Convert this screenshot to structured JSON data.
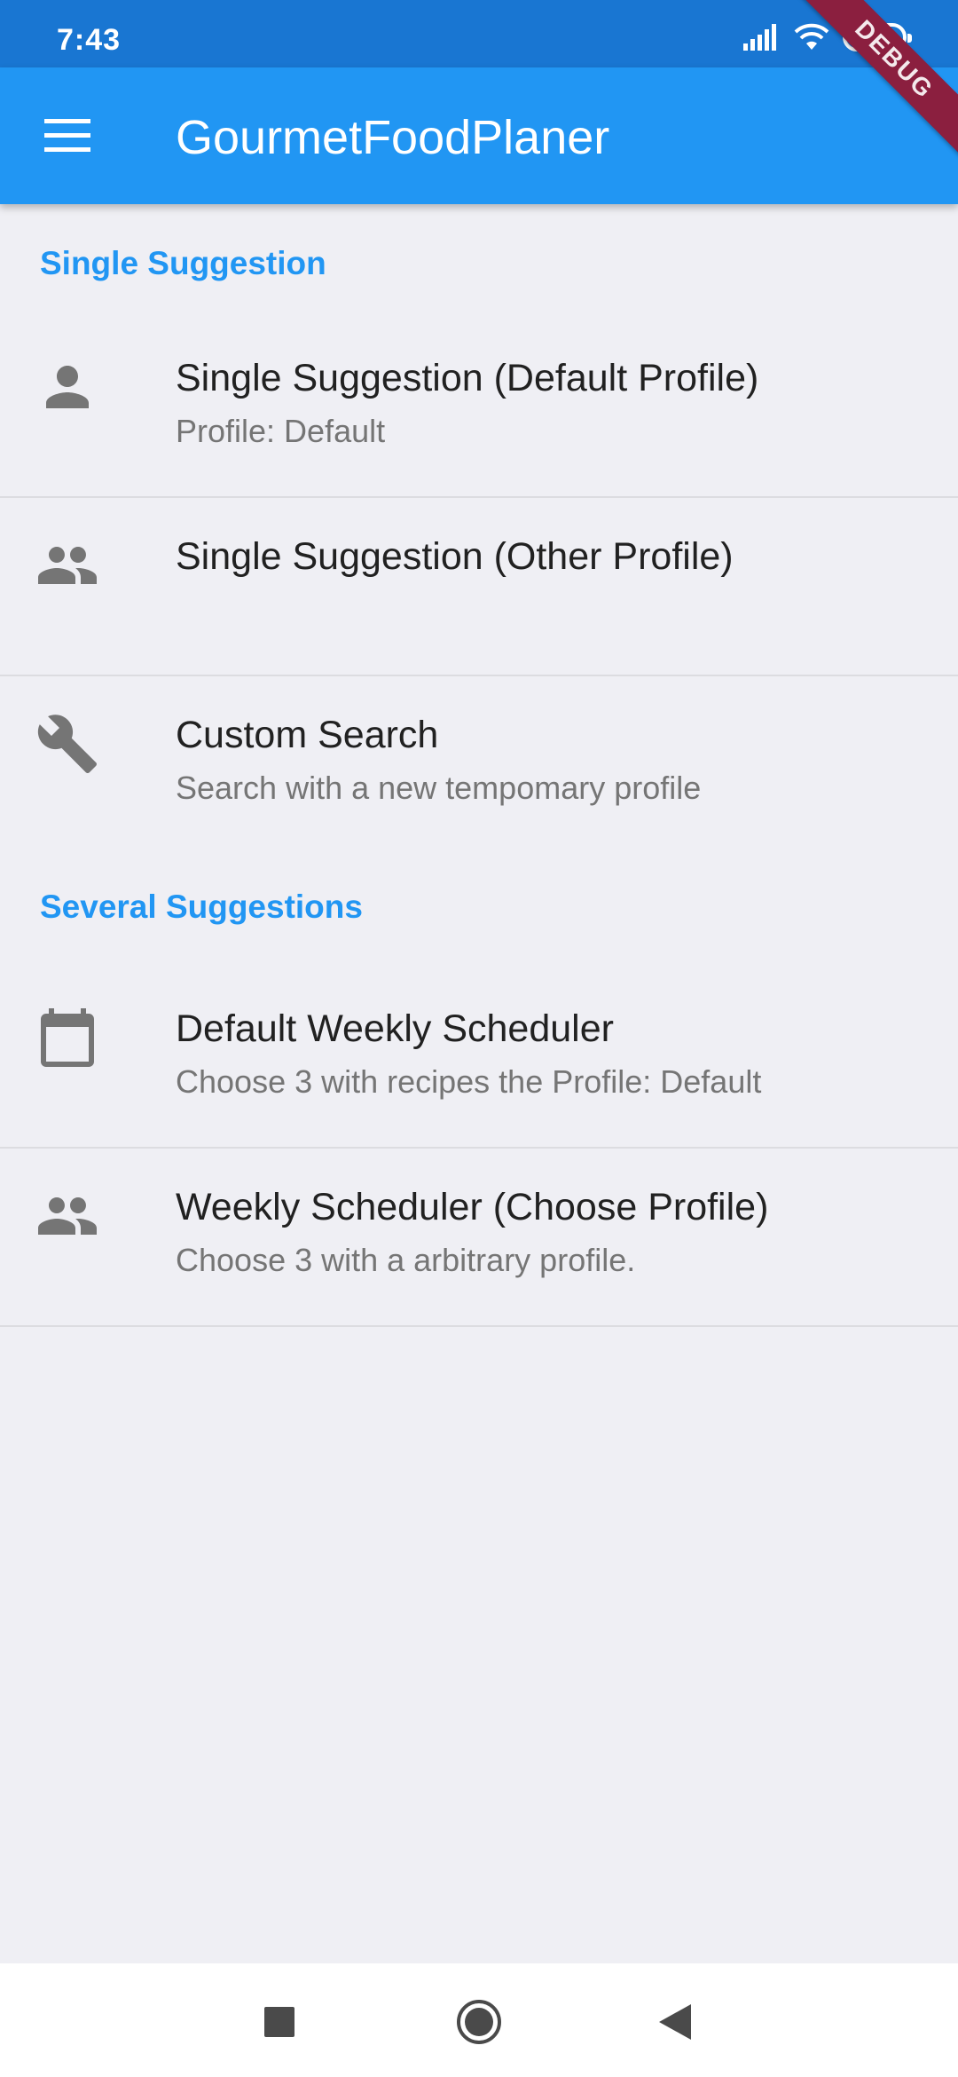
{
  "status_bar": {
    "time": "7:43",
    "battery": "49",
    "icons": [
      "signal-icon",
      "wifi-icon",
      "battery-icon"
    ]
  },
  "app_bar": {
    "title": "GourmetFoodPlaner",
    "menu_icon": "menu-icon",
    "debug_banner": "DEBUG"
  },
  "sections": [
    {
      "header": "Single Suggestion",
      "items": [
        {
          "icon": "person-icon",
          "title": "Single Suggestion (Default Profile)",
          "subtitle": "Profile: Default"
        },
        {
          "icon": "people-icon",
          "title": "Single Suggestion (Other Profile)",
          "subtitle": ""
        },
        {
          "icon": "wrench-icon",
          "title": "Custom Search",
          "subtitle": "Search with a new tempomary profile"
        }
      ]
    },
    {
      "header": "Several Suggestions",
      "items": [
        {
          "icon": "calendar-icon",
          "title": "Default Weekly Scheduler",
          "subtitle": "Choose 3 with recipes the Profile: Default"
        },
        {
          "icon": "people-icon",
          "title": "Weekly Scheduler (Choose Profile)",
          "subtitle": "Choose 3 with a arbitrary profile."
        }
      ]
    }
  ],
  "nav_bar": {
    "icons": [
      "recents-icon",
      "home-icon",
      "back-icon"
    ]
  },
  "colors": {
    "status_bar": "#1976d2",
    "app_bar": "#2196f3",
    "accent": "#2196f3",
    "background": "#efeff4",
    "icon_gray": "#757575"
  }
}
